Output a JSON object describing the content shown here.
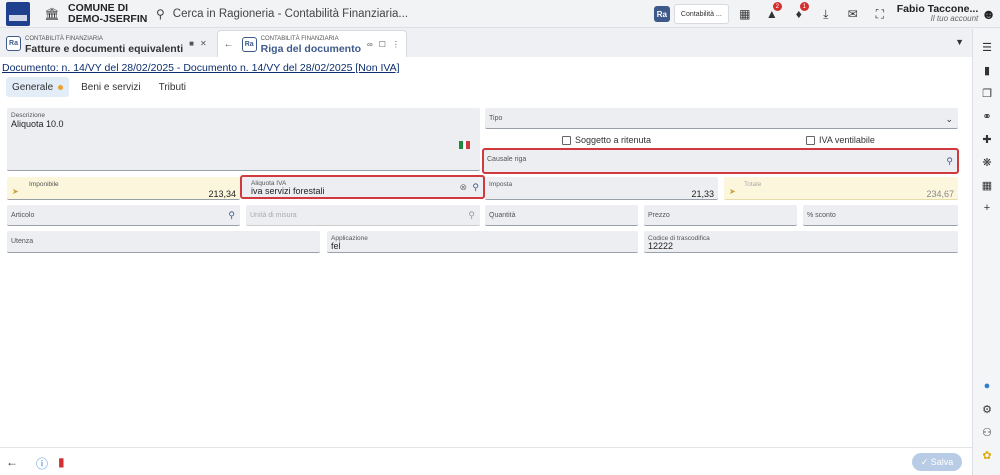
{
  "header": {
    "org_line1": "COMUNE DI",
    "org_line2": "DEMO-JSERFIN",
    "search_placeholder": "Cerca in Ragioneria - Contabilità Finanziaria...",
    "module_badge": "Ra",
    "module_label": "Contabilità ...",
    "notification_counts": {
      "alerts": "2",
      "bell": "1"
    },
    "user_name": "Fabio Taccone...",
    "user_subtitle": "Il tuo account"
  },
  "tabs": [
    {
      "sup": "CONTABILITÀ FINANZIARIA",
      "label": "Fatture e documenti equivalenti",
      "badge": "Ra"
    },
    {
      "sup": "CONTABILITÀ FINANZIARIA",
      "label": "Riga del documento",
      "badge": "Ra"
    }
  ],
  "document_link": "Documento: n. 14/VY del 28/02/2025 - Documento n. 14/VY del 28/02/2025 [Non IVA]",
  "subtabs": [
    "Generale",
    "Beni e servizi",
    "Tributi"
  ],
  "form": {
    "descrizione": {
      "label": "Descrizione",
      "value": "Aliquota 10.0"
    },
    "tipo": {
      "label": "Tipo",
      "value": ""
    },
    "soggetto_ritenuta": {
      "label": "Soggetto a ritenuta",
      "checked": false
    },
    "iva_ventilabile": {
      "label": "IVA ventilabile",
      "checked": false
    },
    "causale_riga": {
      "label": "Causale riga",
      "value": ""
    },
    "imponibile": {
      "label": "Imponibile",
      "value": "213,34"
    },
    "aliquota_iva": {
      "label": "Aliquota IVA",
      "value": "iva servizi forestali"
    },
    "imposta": {
      "label": "Imposta",
      "value": "21,33"
    },
    "totale": {
      "label": "Totale",
      "value": "234,67"
    },
    "articolo": {
      "label": "Articolo",
      "value": ""
    },
    "unita_misura": {
      "label": "Unità di misura",
      "value": ""
    },
    "quantita": {
      "label": "Quantità",
      "value": ""
    },
    "prezzo": {
      "label": "Prezzo",
      "value": ""
    },
    "sconto": {
      "label": "% sconto",
      "value": ""
    },
    "utenza": {
      "label": "Utenza",
      "value": ""
    },
    "applicazione": {
      "label": "Applicazione",
      "value": "fel"
    },
    "codice_trascodifica": {
      "label": "Codice di trascodifica",
      "value": "12222"
    }
  },
  "footer": {
    "save_label": "Salva"
  },
  "colors": {
    "accent": "#3d5a8a",
    "highlight": "#d0393e",
    "yellow_field": "#fbf6dc"
  }
}
